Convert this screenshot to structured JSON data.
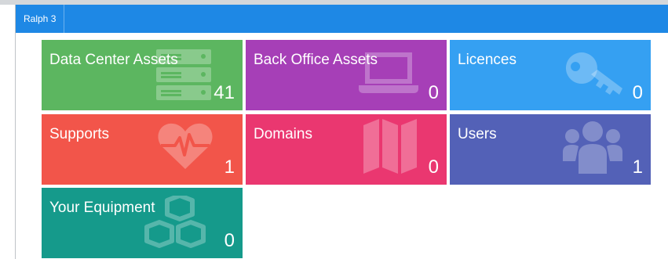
{
  "app": {
    "brand": "Ralph 3",
    "navbar_color": "#1e88e5"
  },
  "tiles": [
    {
      "title": "Data Center Assets",
      "count": "41",
      "icon": "server-icon",
      "color": "#5cb660"
    },
    {
      "title": "Back Office Assets",
      "count": "0",
      "icon": "laptop-icon",
      "color": "#a63fb7"
    },
    {
      "title": "Licences",
      "count": "0",
      "icon": "key-icon",
      "color": "#35a0f2"
    },
    {
      "title": "Supports",
      "count": "1",
      "icon": "heartbeat-icon",
      "color": "#f2554a"
    },
    {
      "title": "Domains",
      "count": "0",
      "icon": "map-icon",
      "color": "#ea3770"
    },
    {
      "title": "Users",
      "count": "1",
      "icon": "users-icon",
      "color": "#5361b7"
    },
    {
      "title": "Your Equipment",
      "count": "0",
      "icon": "cubes-icon",
      "color": "#159a8b"
    }
  ]
}
